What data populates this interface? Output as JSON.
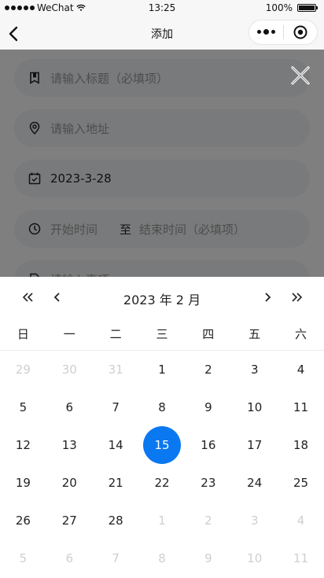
{
  "status_bar": {
    "carrier": "WeChat",
    "time": "13:25",
    "battery": "100%"
  },
  "nav": {
    "title": "添加"
  },
  "form": {
    "title_placeholder": "请输入标题（必填项）",
    "address_placeholder": "请输入地址",
    "date_value": "2023-3-28",
    "start_time_placeholder": "开始时间",
    "to_label": "至",
    "end_time_placeholder": "结束时间（必填项）",
    "content_placeholder": "请输入事项"
  },
  "calendar": {
    "title": "2023 年 2 月",
    "weekdays": [
      "日",
      "一",
      "二",
      "三",
      "四",
      "五",
      "六"
    ],
    "selected_day": "15",
    "days": [
      {
        "d": "29",
        "muted": true
      },
      {
        "d": "30",
        "muted": true
      },
      {
        "d": "31",
        "muted": true
      },
      {
        "d": "1",
        "muted": false
      },
      {
        "d": "2",
        "muted": false
      },
      {
        "d": "3",
        "muted": false
      },
      {
        "d": "4",
        "muted": false
      },
      {
        "d": "5",
        "muted": false
      },
      {
        "d": "6",
        "muted": false
      },
      {
        "d": "7",
        "muted": false
      },
      {
        "d": "8",
        "muted": false
      },
      {
        "d": "9",
        "muted": false
      },
      {
        "d": "10",
        "muted": false
      },
      {
        "d": "11",
        "muted": false
      },
      {
        "d": "12",
        "muted": false
      },
      {
        "d": "13",
        "muted": false
      },
      {
        "d": "14",
        "muted": false
      },
      {
        "d": "15",
        "muted": false
      },
      {
        "d": "16",
        "muted": false
      },
      {
        "d": "17",
        "muted": false
      },
      {
        "d": "18",
        "muted": false
      },
      {
        "d": "19",
        "muted": false
      },
      {
        "d": "20",
        "muted": false
      },
      {
        "d": "21",
        "muted": false
      },
      {
        "d": "22",
        "muted": false
      },
      {
        "d": "23",
        "muted": false
      },
      {
        "d": "24",
        "muted": false
      },
      {
        "d": "25",
        "muted": false
      },
      {
        "d": "26",
        "muted": false
      },
      {
        "d": "27",
        "muted": false
      },
      {
        "d": "28",
        "muted": false
      },
      {
        "d": "1",
        "muted": true
      },
      {
        "d": "2",
        "muted": true
      },
      {
        "d": "3",
        "muted": true
      },
      {
        "d": "4",
        "muted": true
      },
      {
        "d": "5",
        "muted": true
      },
      {
        "d": "6",
        "muted": true
      },
      {
        "d": "7",
        "muted": true
      },
      {
        "d": "8",
        "muted": true
      },
      {
        "d": "9",
        "muted": true
      },
      {
        "d": "10",
        "muted": true
      },
      {
        "d": "11",
        "muted": true
      }
    ]
  },
  "colors": {
    "accent": "#0a78f0",
    "muted_text": "#cfcfcf",
    "overlay": "rgba(0,0,0,0.5)"
  }
}
